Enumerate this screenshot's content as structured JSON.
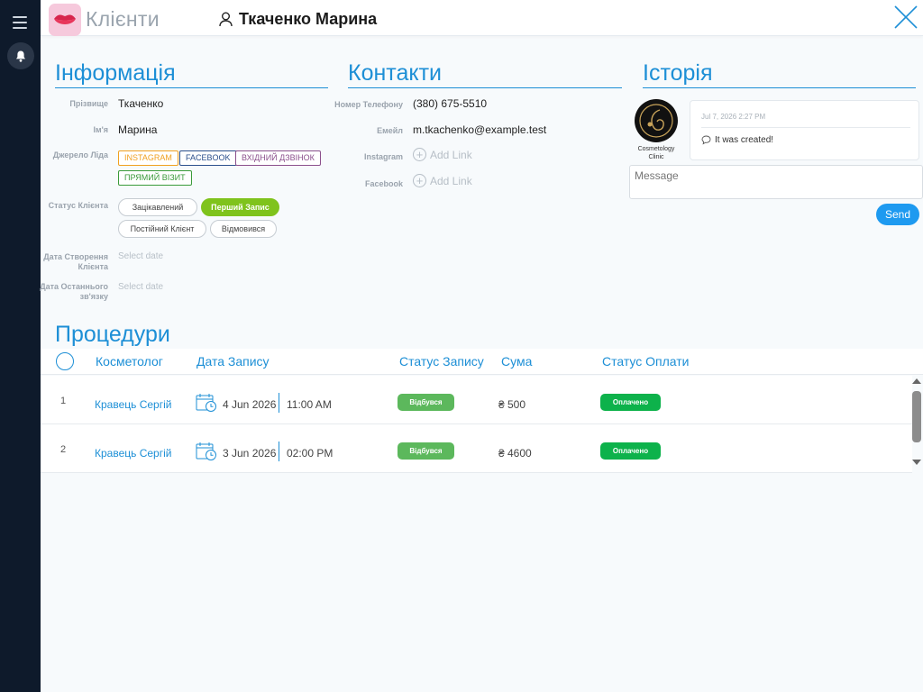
{
  "colors": {
    "accent": "#1d8fd6",
    "active_status": "#7fc31c",
    "record_status": "#5cb85c",
    "paid": "#0db24b",
    "rail": "#0e1a2b"
  },
  "header": {
    "app_title": "Клієнти",
    "client_name": "Ткаченко Марина"
  },
  "info": {
    "title": "Інформація",
    "surname_label": "Прізвище",
    "surname": "Ткаченко",
    "name_label": "Ім'я",
    "name": "Марина",
    "lead_source_label": "Джерело Ліда",
    "lead_sources": [
      {
        "label": "INSTAGRAM",
        "color": "#f0a020"
      },
      {
        "label": "FACEBOOK",
        "color": "#2b4f8c"
      },
      {
        "label": "ВХІДНИЙ ДЗВІНОК",
        "color": "#8b4f8c"
      },
      {
        "label": "ПРЯМИЙ ВІЗИТ",
        "color": "#3a9a3a"
      }
    ],
    "status_label": "Статус Клієнта",
    "statuses": [
      {
        "label": "Зацікавлений",
        "active": false
      },
      {
        "label": "Перший Запис",
        "active": true
      },
      {
        "label": "Постійний Клієнт",
        "active": false
      },
      {
        "label": "Відмовився",
        "active": false
      }
    ],
    "created_label": "Дата Створення Клієнта",
    "created_placeholder": "Select date",
    "last_contact_label": "Дата Останнього зв'язку",
    "last_contact_placeholder": "Select date"
  },
  "contacts": {
    "title": "Контакти",
    "phone_label": "Номер Телефону",
    "phone": "(380) 675-5510",
    "email_label": "Емейл",
    "email": "m.tkachenko@example.test",
    "instagram_label": "Instagram",
    "instagram_action": "Add Link",
    "facebook_label": "Facebook",
    "facebook_action": "Add Link"
  },
  "history": {
    "title": "Історія",
    "clinic_name": "Cosmetology Clinic",
    "entries": [
      {
        "date": "Jul 7, 2026 2:27 PM",
        "text": "It was created!"
      }
    ],
    "message_placeholder": "Message",
    "send_label": "Send"
  },
  "procedures": {
    "title": "Процедури",
    "columns": {
      "cosmetologist": "Косметолог",
      "date": "Дата Запису",
      "record_status": "Статус Запису",
      "sum": "Сума",
      "payment_status": "Статус Оплати"
    },
    "rows": [
      {
        "num": "1",
        "cosmetologist": "Кравець Сергій",
        "date": "4 Jun 2026",
        "time": "11:00 AM",
        "record_status": "Відбувся",
        "sum": "₴ 500",
        "payment_status": "Оплачено"
      },
      {
        "num": "2",
        "cosmetologist": "Кравець Сергій",
        "date": "3 Jun 2026",
        "time": "02:00 PM",
        "record_status": "Відбувся",
        "sum": "₴ 4600",
        "payment_status": "Оплачено"
      }
    ]
  }
}
